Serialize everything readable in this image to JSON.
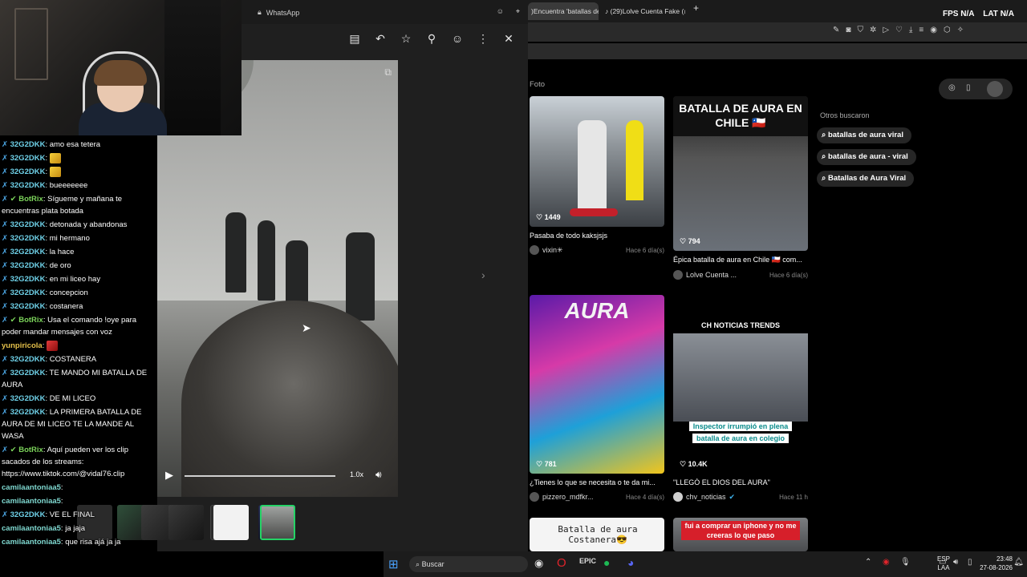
{
  "whatsapp": {
    "title": "WhatsApp",
    "toolbar_icons": [
      "note-icon",
      "reply-icon",
      "star-icon",
      "pin-icon",
      "emoji-icon",
      "more-icon",
      "close-icon"
    ],
    "video": {
      "speed": "1.0x",
      "progress": 0
    }
  },
  "chat": {
    "messages": [
      {
        "user": "32G2DKK",
        "text": "amo esa tetera",
        "badge": "x",
        "color": "blue"
      },
      {
        "user": "32G2DKK",
        "text": "",
        "emote": "yellow",
        "badge": "x",
        "color": "blue"
      },
      {
        "user": "32G2DKK",
        "text": "",
        "emote": "yellow",
        "badge": "x",
        "color": "blue"
      },
      {
        "user": "32G2DKK",
        "text": "bueeeeeee",
        "badge": "x",
        "color": "blue"
      },
      {
        "user": "BotRix",
        "text": "Sígueme y mañana te encuentras plata botada",
        "badge": "x-ok",
        "color": "green"
      },
      {
        "user": "32G2DKK",
        "text": "detonada y abandonas",
        "badge": "x",
        "color": "blue"
      },
      {
        "user": "32G2DKK",
        "text": "mi hermano",
        "badge": "x",
        "color": "blue"
      },
      {
        "user": "32G2DKK",
        "text": "la hace",
        "badge": "x",
        "color": "blue"
      },
      {
        "user": "32G2DKK",
        "text": "de oro",
        "badge": "x",
        "color": "blue"
      },
      {
        "user": "32G2DKK",
        "text": "en mi liceo hay",
        "badge": "x",
        "color": "blue"
      },
      {
        "user": "32G2DKK",
        "text": "concepcion",
        "badge": "x",
        "color": "blue"
      },
      {
        "user": "32G2DKK",
        "text": "costanera",
        "badge": "x",
        "color": "blue"
      },
      {
        "user": "BotRix",
        "text": "Usa el comando !oye para poder mandar mensajes con voz",
        "badge": "x-ok",
        "color": "green"
      },
      {
        "user": "yunpiricola",
        "text": "",
        "emote": "red",
        "badge": "",
        "color": "yellow"
      },
      {
        "user": "32G2DKK",
        "text": "COSTANERA",
        "badge": "x",
        "color": "blue"
      },
      {
        "user": "32G2DKK",
        "text": "TE MANDO MI BATALLA DE AURA",
        "badge": "x",
        "color": "blue"
      },
      {
        "user": "32G2DKK",
        "text": "DE MI LICEO",
        "badge": "x",
        "color": "blue"
      },
      {
        "user": "32G2DKK",
        "text": "LA PRIMERA BATALLA DE AURA DE MI LICEO TE LA MANDE AL WASA",
        "badge": "x",
        "color": "blue"
      },
      {
        "user": "BotRix",
        "text": "Aquí pueden ver los clip sacados de los streams: https://www.tiktok.com/@vidal76.clip",
        "badge": "x-ok",
        "color": "green"
      },
      {
        "user": "camilaantoniaa5",
        "text": "",
        "badge": "",
        "color": "teal"
      },
      {
        "user": "camilaantoniaa5",
        "text": "",
        "badge": "",
        "color": "teal"
      },
      {
        "user": "32G2DKK",
        "text": "VE EL FINAL",
        "badge": "x",
        "color": "blue"
      },
      {
        "user": "camilaantoniaa5",
        "text": "ja jaja",
        "badge": "",
        "color": "teal"
      },
      {
        "user": "camilaantoniaa5",
        "text": "que risa ajá ja ja",
        "badge": "",
        "color": "teal"
      }
    ]
  },
  "browser": {
    "tabs": [
      {
        "label": ")Encuentra 'batallas de"
      },
      {
        "label": "(29)Lolve Cuenta Fake (@"
      }
    ],
    "fps_label": "FPS",
    "fps_value": "N/A",
    "lat_label": "LAT",
    "lat_value": "N/A",
    "section_label": "Foto",
    "others_title": "Otros buscaron",
    "others": [
      "batallas de aura viral",
      "batallas de aura - viral",
      "Batallas de Aura Viral"
    ],
    "cards": [
      {
        "likes": "1449",
        "caption": "Pasaba de todo kaksjsjs",
        "author": "vixin✳",
        "time": "Hace 6 día(s)"
      },
      {
        "likes": "794",
        "caption": "Épica batalla de aura en Chile 🇨🇱 com...",
        "author": "Lolve Cuenta ...",
        "time": "Hace 6 día(s)",
        "overlay": "BATALLA DE AURA EN CHILE 🇨🇱"
      },
      {
        "likes": "781",
        "caption": "¿Tienes lo que se necesita o te da mi...",
        "author": "pizzero_mdfkr...",
        "time": "Hace 4 día(s)",
        "overlay": "AURA"
      },
      {
        "likes": "10.4K",
        "caption": "\"LLEGÓ EL DIOS DEL AURA\"",
        "author": "chv_noticias",
        "time": "Hace 11 h",
        "overlay": "CH NOTICIAS TRENDS",
        "sub1": "Inspector irrumpió en plena",
        "sub2": "batalla de aura en colegio"
      },
      {
        "overlay": "Batalla de aura Costanera😎"
      },
      {
        "overlay": "fui a comprar un iphone y no me creeras lo que paso"
      }
    ]
  },
  "taskbar": {
    "search_placeholder": "Buscar",
    "lang1": "ESP",
    "lang2": "LAA",
    "time": "23:48",
    "date": "27-08-2026"
  }
}
